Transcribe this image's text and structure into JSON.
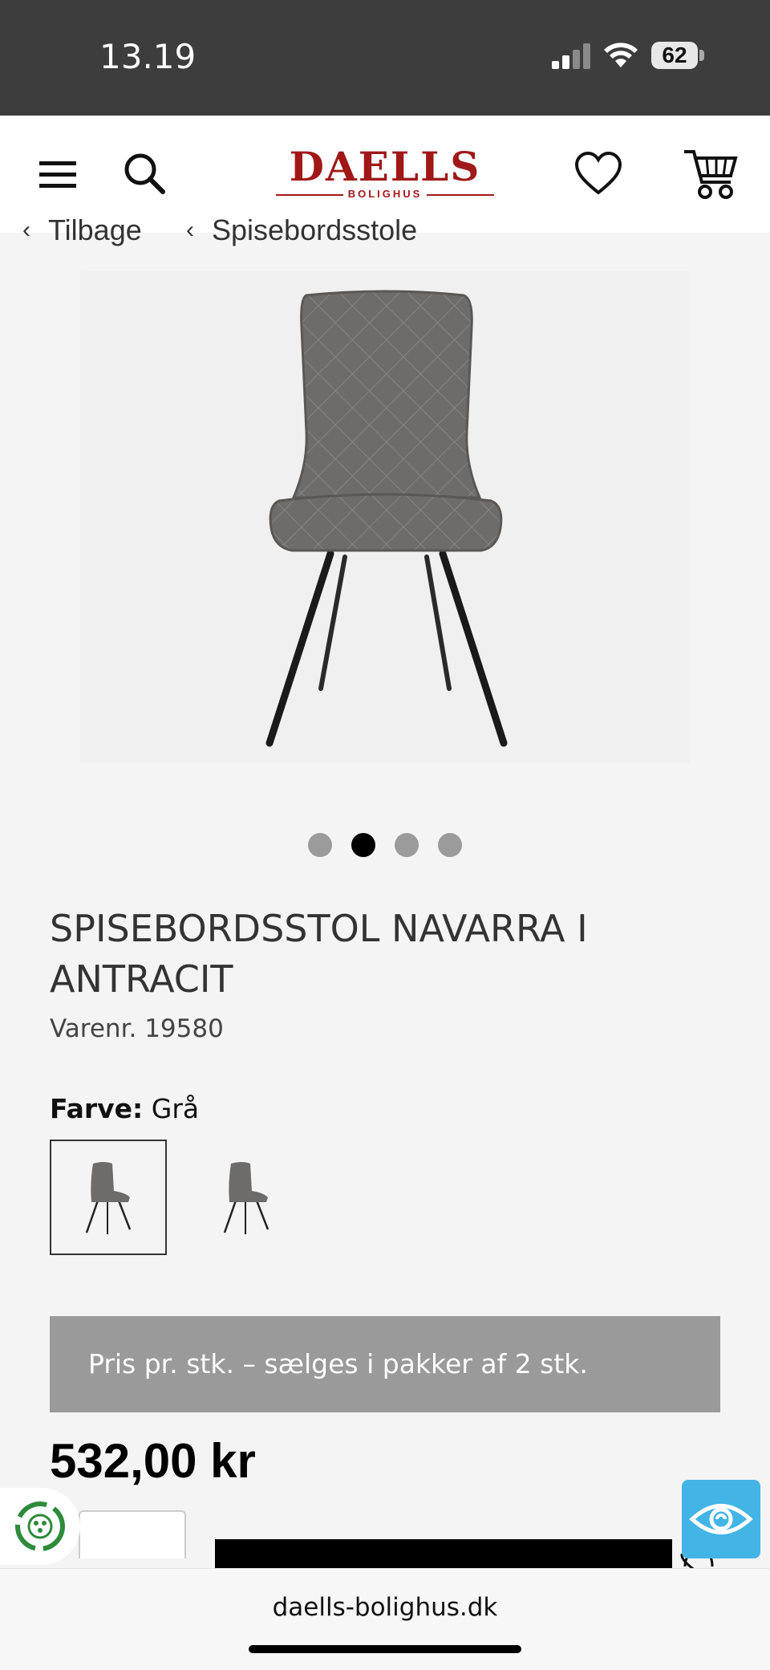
{
  "status_bar": {
    "time": "13.19",
    "battery": "62"
  },
  "header": {
    "brand": "DAELLS",
    "brand_sub": "BOLIGHUS"
  },
  "breadcrumb": {
    "back_label": "Tilbage",
    "category_label": "Spisebordsstole"
  },
  "gallery": {
    "count": 4,
    "active_index": 1
  },
  "product": {
    "title": "SPISEBORDSSTOL NAVARRA I ANTRACIT",
    "sku": "Varenr. 19580",
    "color_label": "Farve:",
    "color_value": "Grå",
    "notice": "Pris pr. stk. – sælges i pakker af 2 stk.",
    "price": "532,00 kr"
  },
  "browser": {
    "url": "daells-bolighus.dk"
  },
  "colors": {
    "brand_red": "#a01818",
    "eye_blue": "#42b4e6",
    "eco_green": "#2e8b3a"
  }
}
